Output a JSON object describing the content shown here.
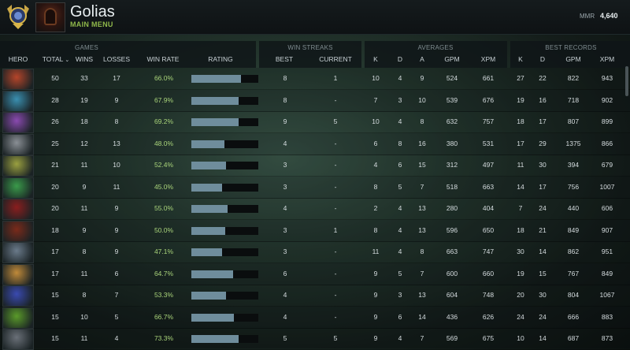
{
  "profile": {
    "name": "Golias",
    "subtitle": "MAIN MENU",
    "mmr_label": "MMR",
    "mmr_value": "4,640"
  },
  "groups": {
    "games": "GAMES",
    "win_streaks": "WIN STREAKS",
    "averages": "AVERAGES",
    "best_records": "BEST RECORDS"
  },
  "columns": {
    "hero": "HERO",
    "total": "TOTAL",
    "wins": "WINS",
    "losses": "LOSSES",
    "win_rate": "WIN RATE",
    "rating": "RATING",
    "best": "BEST",
    "current": "CURRENT",
    "k": "K",
    "d": "D",
    "a": "A",
    "gpm": "GPM",
    "xpm": "XPM",
    "rec_k": "K",
    "rec_d": "D",
    "rec_gpm": "GPM",
    "rec_xpm": "XPM"
  },
  "sort_icon": "chevron-down",
  "rows": [
    {
      "total": "50",
      "wins": "33",
      "losses": "17",
      "win_rate": "66.0%",
      "rating": 0.74,
      "best": "8",
      "current": "1",
      "k": "10",
      "d": "4",
      "a": "9",
      "gpm": "524",
      "xpm": "661",
      "rk": "27",
      "rd": "22",
      "rgpm": "822",
      "rxpm": "943",
      "hero_color": "#b5452a"
    },
    {
      "total": "28",
      "wins": "19",
      "losses": "9",
      "win_rate": "67.9%",
      "rating": 0.71,
      "best": "8",
      "current": "-",
      "k": "7",
      "d": "3",
      "a": "10",
      "gpm": "539",
      "xpm": "676",
      "rk": "19",
      "rd": "16",
      "rgpm": "718",
      "rxpm": "902",
      "hero_color": "#3a8fb0"
    },
    {
      "total": "26",
      "wins": "18",
      "losses": "8",
      "win_rate": "69.2%",
      "rating": 0.71,
      "best": "9",
      "current": "5",
      "k": "10",
      "d": "4",
      "a": "8",
      "gpm": "632",
      "xpm": "757",
      "rk": "18",
      "rd": "17",
      "rgpm": "807",
      "rxpm": "899",
      "hero_color": "#8a4ab0"
    },
    {
      "total": "25",
      "wins": "12",
      "losses": "13",
      "win_rate": "48.0%",
      "rating": 0.49,
      "best": "4",
      "current": "-",
      "k": "6",
      "d": "8",
      "a": "16",
      "gpm": "380",
      "xpm": "531",
      "rk": "17",
      "rd": "29",
      "rgpm": "1375",
      "rxpm": "866",
      "hero_color": "#8a8f95"
    },
    {
      "total": "21",
      "wins": "11",
      "losses": "10",
      "win_rate": "52.4%",
      "rating": 0.52,
      "best": "3",
      "current": "-",
      "k": "4",
      "d": "6",
      "a": "15",
      "gpm": "312",
      "xpm": "497",
      "rk": "11",
      "rd": "30",
      "rgpm": "394",
      "rxpm": "679",
      "hero_color": "#9aa040"
    },
    {
      "total": "20",
      "wins": "9",
      "losses": "11",
      "win_rate": "45.0%",
      "rating": 0.46,
      "best": "3",
      "current": "-",
      "k": "8",
      "d": "5",
      "a": "7",
      "gpm": "518",
      "xpm": "663",
      "rk": "14",
      "rd": "17",
      "rgpm": "756",
      "rxpm": "1007",
      "hero_color": "#3a9a4a"
    },
    {
      "total": "20",
      "wins": "11",
      "losses": "9",
      "win_rate": "55.0%",
      "rating": 0.54,
      "best": "4",
      "current": "-",
      "k": "2",
      "d": "4",
      "a": "13",
      "gpm": "280",
      "xpm": "404",
      "rk": "7",
      "rd": "24",
      "rgpm": "440",
      "rxpm": "606",
      "hero_color": "#8a1e1e"
    },
    {
      "total": "18",
      "wins": "9",
      "losses": "9",
      "win_rate": "50.0%",
      "rating": 0.5,
      "best": "3",
      "current": "1",
      "k": "8",
      "d": "4",
      "a": "13",
      "gpm": "596",
      "xpm": "650",
      "rk": "18",
      "rd": "21",
      "rgpm": "849",
      "rxpm": "907",
      "hero_color": "#7a2a1a"
    },
    {
      "total": "17",
      "wins": "8",
      "losses": "9",
      "win_rate": "47.1%",
      "rating": 0.46,
      "best": "3",
      "current": "-",
      "k": "11",
      "d": "4",
      "a": "8",
      "gpm": "663",
      "xpm": "747",
      "rk": "30",
      "rd": "14",
      "rgpm": "862",
      "rxpm": "951",
      "hero_color": "#6a7a8a"
    },
    {
      "total": "17",
      "wins": "11",
      "losses": "6",
      "win_rate": "64.7%",
      "rating": 0.62,
      "best": "6",
      "current": "-",
      "k": "9",
      "d": "5",
      "a": "7",
      "gpm": "600",
      "xpm": "660",
      "rk": "19",
      "rd": "15",
      "rgpm": "767",
      "rxpm": "849",
      "hero_color": "#c08a3a"
    },
    {
      "total": "15",
      "wins": "8",
      "losses": "7",
      "win_rate": "53.3%",
      "rating": 0.52,
      "best": "4",
      "current": "-",
      "k": "9",
      "d": "3",
      "a": "13",
      "gpm": "604",
      "xpm": "748",
      "rk": "20",
      "rd": "30",
      "rgpm": "804",
      "rxpm": "1067",
      "hero_color": "#3a4ab0"
    },
    {
      "total": "15",
      "wins": "10",
      "losses": "5",
      "win_rate": "66.7%",
      "rating": 0.63,
      "best": "4",
      "current": "-",
      "k": "9",
      "d": "6",
      "a": "14",
      "gpm": "436",
      "xpm": "626",
      "rk": "24",
      "rd": "24",
      "rgpm": "666",
      "rxpm": "883",
      "hero_color": "#5a9a2a"
    },
    {
      "total": "15",
      "wins": "11",
      "losses": "4",
      "win_rate": "73.3%",
      "rating": 0.7,
      "best": "5",
      "current": "5",
      "k": "9",
      "d": "4",
      "a": "7",
      "gpm": "569",
      "xpm": "675",
      "rk": "10",
      "rd": "14",
      "rgpm": "687",
      "rxpm": "873",
      "hero_color": "#6a7078"
    }
  ]
}
